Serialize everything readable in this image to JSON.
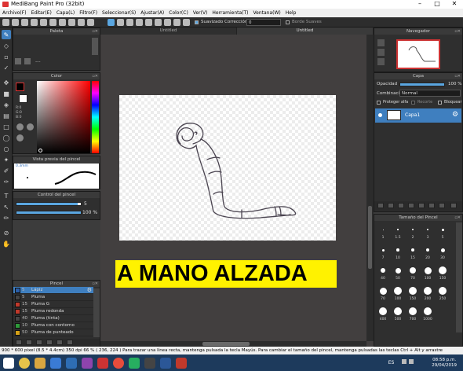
{
  "window": {
    "title": "MediBang Paint Pro (32bit)",
    "controls": [
      "–",
      "□",
      "✕"
    ]
  },
  "menu": [
    "Archivo(F)",
    "Editar(E)",
    "Capa(L)",
    "Filtro(F)",
    "Seleccionar(S)",
    "Ajustar(A)",
    "Color(C)",
    "Ver(V)",
    "Herramienta(T)",
    "Ventana(W)",
    "Help"
  ],
  "toolbar": {
    "antialias_label": "Suavizado",
    "correction_label": "Corrección",
    "correction_value": "0",
    "border_label": "Borde Suaves"
  },
  "doc_tabs": [
    "Untitled",
    "Untitled"
  ],
  "panels": {
    "palette_title": "Paleta",
    "palette_text": "---",
    "color_title": "Color",
    "color_r": "R:0",
    "color_g": "G:0",
    "color_b": "B:0",
    "brush_preview_title": "Vista previa del pincel",
    "brush_preview_size": "0.3mm",
    "brush_control_title": "Control del pincel",
    "brush_size_value": "5",
    "brush_size_fraction": 0.95,
    "brush_opacity_value": "100 %",
    "brush_opacity_fraction": 1.0,
    "brush_list_title": "Pincel",
    "brushes": [
      {
        "size": "5",
        "name": "Lápiz",
        "color": "#2a5ea8",
        "selected": true
      },
      {
        "size": "5",
        "name": "Pluma",
        "color": "#444444",
        "selected": false
      },
      {
        "size": "15",
        "name": "Pluma G",
        "color": "#c0392b",
        "selected": false
      },
      {
        "size": "15",
        "name": "Pluma redonda",
        "color": "#c0392b",
        "selected": false
      },
      {
        "size": "40",
        "name": "Pluma (tinta)",
        "color": "#444444",
        "selected": false
      },
      {
        "size": "10",
        "name": "Pluma con contorno",
        "color": "#2e9a3a",
        "selected": false
      },
      {
        "size": "50",
        "name": "Pluma de punteado",
        "color": "#d4a017",
        "selected": false
      }
    ],
    "navigator_title": "Navegador",
    "layer_title": "Capa",
    "opacity_label": "Opacidad",
    "opacity_value": "100 %",
    "opacity_fraction": 1.0,
    "blend_label": "Combinación",
    "blend_value": "Normal",
    "protect_alpha": "Proteger alfa",
    "clipping": "Recorte",
    "lock": "Bloquear",
    "layer_name": "Capa1",
    "brush_size_title": "Tamaño del Pincel",
    "sizes_row1": [
      "1",
      "1.5",
      "2",
      "3",
      "5"
    ],
    "sizes_row2": [
      "7",
      "10",
      "15",
      "20",
      "30"
    ],
    "sizes_row3": [
      "40",
      "50",
      "70",
      "100",
      "150"
    ],
    "sizes_row4": [
      "70",
      "100",
      "150",
      "200",
      "250"
    ],
    "sizes_row5": [
      "400",
      "500",
      "700",
      "1000"
    ]
  },
  "caption": "A MANO ALZADA",
  "status": "900 * 600 pixel  (8.5 * 4.4cm)  350 dpi  66 %  ( 236, 224 )  Para trazar una línea recta, mantenga pulsada la tecla Mayús. Para cambiar el tamaño del pincel, mantenga pulsadas las teclas Ctrl + Alt y arrastre",
  "taskbar": {
    "lang": "ES",
    "time": "08:58 p.m.",
    "date": "29/04/2019"
  }
}
